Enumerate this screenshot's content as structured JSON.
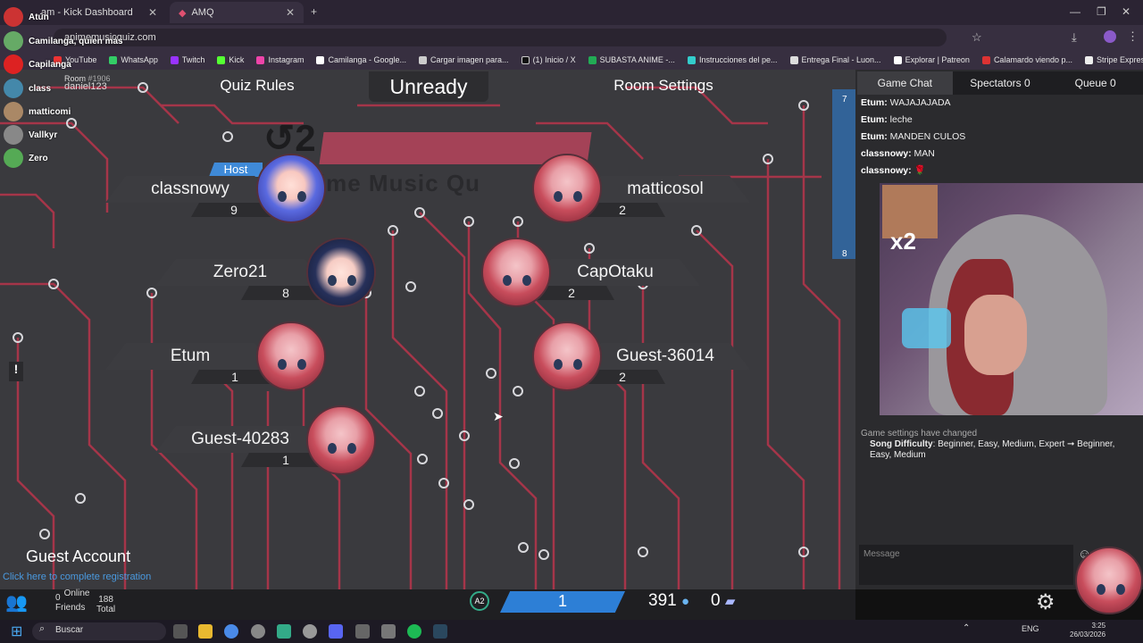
{
  "browser": {
    "tabs": [
      {
        "label": "am - Kick Dashboard",
        "active": false
      },
      {
        "label": "AMQ",
        "active": true
      }
    ],
    "url": "animemusicquiz.com",
    "bookmarks": [
      "YouTube",
      "WhatsApp",
      "Twitch",
      "Kick",
      "Instagram",
      "Camilanga - Google...",
      "Cargar imagen para...",
      "(1) Inicio / X",
      "SUBASTA ANIME -...",
      "Instrucciones del pe...",
      "Entrega Final - Luon...",
      "Explorar | Patreon",
      "Calamardo viendo p...",
      "Stripe Express"
    ]
  },
  "stream_overlay": {
    "items": [
      "Atún",
      "Camilanga, quien más",
      "Capilanga",
      "class",
      "matticomi",
      "Vallkyr",
      "Zero"
    ]
  },
  "room": {
    "label": "Room",
    "number": "#1906",
    "owner": "daniel123",
    "quiz_rules": "Quiz Rules",
    "unready": "Unready",
    "room_settings": "Room Settings",
    "logo_text": "nime Music Qu"
  },
  "players": [
    {
      "name": "classnowy",
      "score": "9",
      "host": true,
      "avatar": "blue"
    },
    {
      "name": "Zero21",
      "score": "8",
      "host": false,
      "avatar": "navy"
    },
    {
      "name": "Etum",
      "score": "1",
      "host": false,
      "avatar": "red"
    },
    {
      "name": "Guest-40283",
      "score": "1",
      "host": false,
      "avatar": "red"
    },
    {
      "name": "matticosol",
      "score": "2",
      "host": false,
      "avatar": "red"
    },
    {
      "name": "CapOtaku",
      "score": "2",
      "host": false,
      "avatar": "red"
    },
    {
      "name": "Guest-36014",
      "score": "2",
      "host": false,
      "avatar": "red"
    }
  ],
  "host_label": "Host",
  "account": {
    "title": "Guest Account",
    "link": "Click here to complete registration"
  },
  "footer": {
    "online": "0",
    "online_label": "Online",
    "friends_label": "Friends",
    "total": "188",
    "total_label": "Total",
    "level": "1",
    "notes": "391",
    "tickets": "0",
    "badge": "A2"
  },
  "chat": {
    "tabs": [
      {
        "label": "Game Chat"
      },
      {
        "label": "Spectators",
        "count": "0"
      },
      {
        "label": "Queue",
        "count": "0"
      }
    ],
    "side_numbers": [
      "7",
      "8"
    ],
    "messages": [
      {
        "user": "Etum:",
        "text": "WAJAJAJADA"
      },
      {
        "user": "Etum:",
        "text": "leche"
      },
      {
        "user": "Etum:",
        "text": "MANDEN CULOS"
      },
      {
        "user": "classnowy:",
        "text": "MAN"
      },
      {
        "user": "classnowy:",
        "text": "🌹"
      }
    ],
    "settings_msg": "Game settings have changed",
    "difficulty_label": "Song Difficulty",
    "difficulty_text": ": Beginner, Easy, Medium, Expert ➞ Beginner, Easy, Medium",
    "message_placeholder": "Message",
    "webcam_overlay": "x2"
  },
  "taskbar": {
    "search": "Buscar",
    "lang": "ENG",
    "time": "3:25",
    "date": "26/03/2026"
  },
  "colors": {
    "accent": "#2d7fd6",
    "circuit": "#c0394f",
    "host": "#3f8ad8"
  }
}
